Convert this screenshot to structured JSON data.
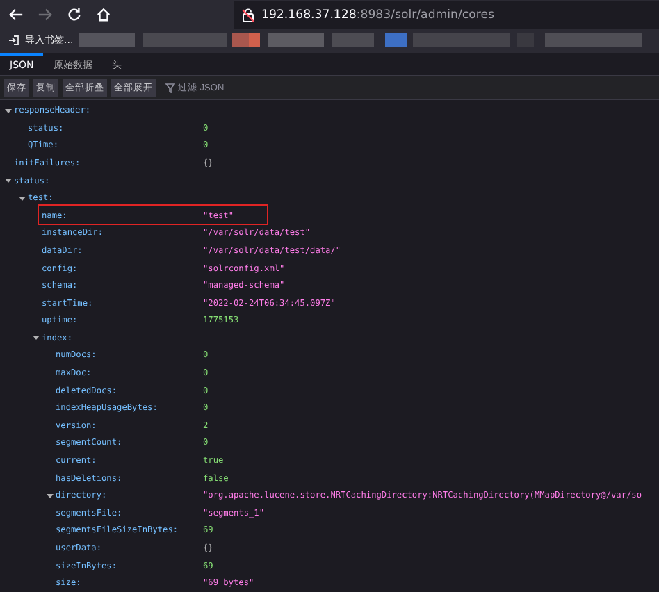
{
  "address_bar": {
    "host": "192.168.37.128",
    "path": ":8983/solr/admin/cores"
  },
  "bookmarks": {
    "import_label": "导入书签..."
  },
  "tabs": [
    {
      "label": "JSON",
      "selected": true
    },
    {
      "label": "原始数据",
      "selected": false
    },
    {
      "label": "头",
      "selected": false
    }
  ],
  "toolbar": {
    "buttons": [
      "保存",
      "复制",
      "全部折叠",
      "全部展开"
    ],
    "filter": {
      "placeholder": "过滤 JSON"
    }
  },
  "tree": [
    {
      "key": "responseHeader:",
      "expanded": true,
      "children": [
        {
          "key": "status:",
          "value": "0",
          "kind": "number"
        },
        {
          "key": "QTime:",
          "value": "0",
          "kind": "number"
        }
      ]
    },
    {
      "key": "initFailures:",
      "value": "{}",
      "kind": "object"
    },
    {
      "key": "status:",
      "expanded": true,
      "children": [
        {
          "key": "test:",
          "expanded": true,
          "children": [
            {
              "key": "name:",
              "value": "\"test\"",
              "kind": "string",
              "highlighted": true
            },
            {
              "key": "instanceDir:",
              "value": "\"/var/solr/data/test\"",
              "kind": "string"
            },
            {
              "key": "dataDir:",
              "value": "\"/var/solr/data/test/data/\"",
              "kind": "string"
            },
            {
              "key": "config:",
              "value": "\"solrconfig.xml\"",
              "kind": "string"
            },
            {
              "key": "schema:",
              "value": "\"managed-schema\"",
              "kind": "string"
            },
            {
              "key": "startTime:",
              "value": "\"2022-02-24T06:34:45.097Z\"",
              "kind": "string"
            },
            {
              "key": "uptime:",
              "value": "1775153",
              "kind": "number"
            },
            {
              "key": "index:",
              "expanded": true,
              "children": [
                {
                  "key": "numDocs:",
                  "value": "0",
                  "kind": "number"
                },
                {
                  "key": "maxDoc:",
                  "value": "0",
                  "kind": "number"
                },
                {
                  "key": "deletedDocs:",
                  "value": "0",
                  "kind": "number"
                },
                {
                  "key": "indexHeapUsageBytes:",
                  "value": "0",
                  "kind": "number"
                },
                {
                  "key": "version:",
                  "value": "2",
                  "kind": "number"
                },
                {
                  "key": "segmentCount:",
                  "value": "0",
                  "kind": "number"
                },
                {
                  "key": "current:",
                  "value": "true",
                  "kind": "boolean"
                },
                {
                  "key": "hasDeletions:",
                  "value": "false",
                  "kind": "boolean"
                },
                {
                  "key": "directory:",
                  "expanded": true,
                  "value": "\"org.apache.lucene.store.NRTCachingDirectory:NRTCachingDirectory(MMapDirectory@/var/so",
                  "kind": "string"
                },
                {
                  "key": "segmentsFile:",
                  "value": "\"segments_1\"",
                  "kind": "string"
                },
                {
                  "key": "segmentsFileSizeInBytes:",
                  "value": "69",
                  "kind": "number"
                },
                {
                  "key": "userData:",
                  "value": "{}",
                  "kind": "object"
                },
                {
                  "key": "sizeInBytes:",
                  "value": "69",
                  "kind": "number"
                },
                {
                  "key": "size:",
                  "value": "\"69 bytes\"",
                  "kind": "string"
                }
              ]
            }
          ]
        }
      ]
    }
  ]
}
